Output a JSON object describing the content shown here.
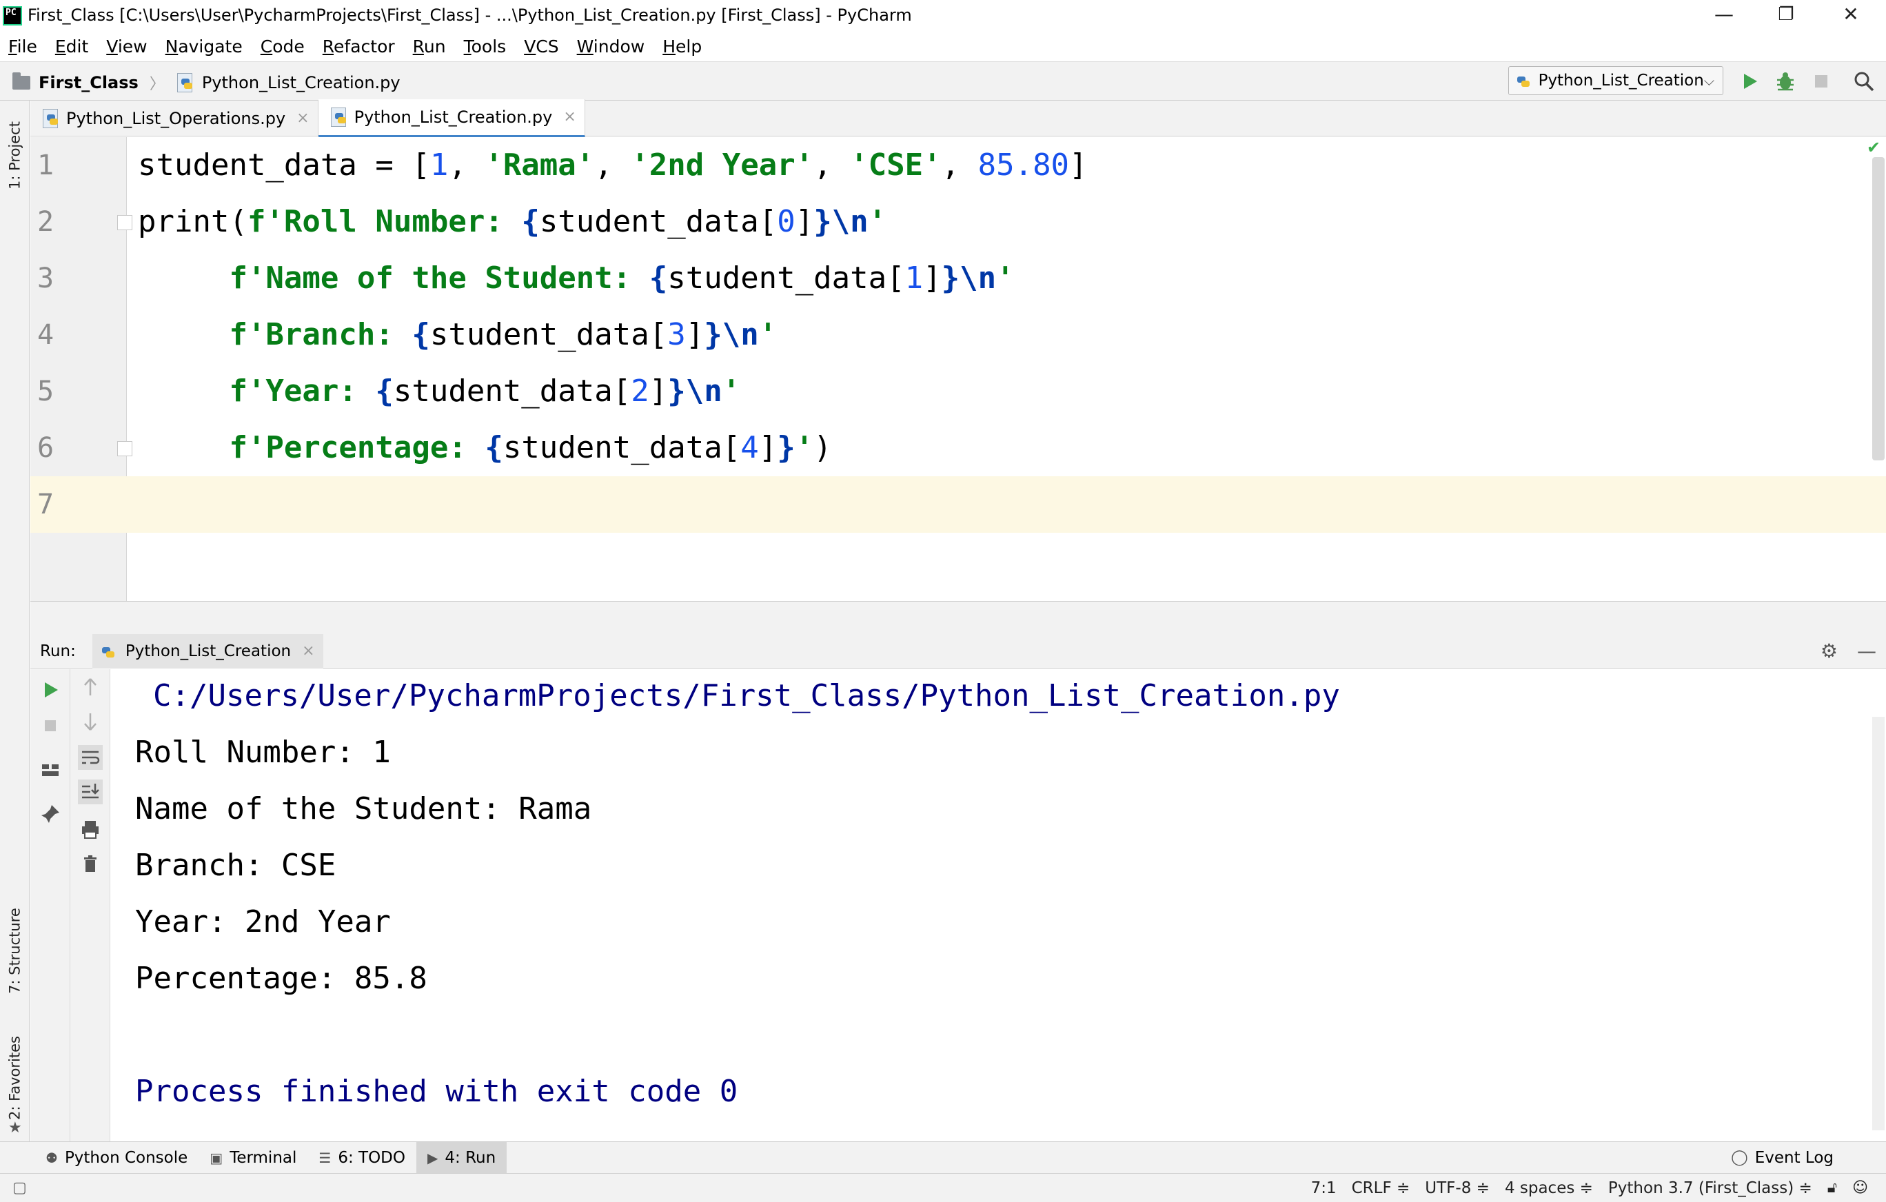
{
  "window": {
    "title": "First_Class [C:\\Users\\User\\PycharmProjects\\First_Class] - ...\\Python_List_Creation.py [First_Class] - PyCharm",
    "app_icon_text": "PC",
    "minimize": "—",
    "restore": "❐",
    "close": "✕"
  },
  "menu": [
    "File",
    "Edit",
    "View",
    "Navigate",
    "Code",
    "Refactor",
    "Run",
    "Tools",
    "VCS",
    "Window",
    "Help"
  ],
  "navbar": {
    "project": "First_Class",
    "file": "Python_List_Creation.py",
    "run_config": "Python_List_Creation"
  },
  "left_strip": {
    "project": "1: Project",
    "structure": "7: Structure",
    "favorites": "2: Favorites"
  },
  "editor_tabs": [
    {
      "label": "Python_List_Operations.py",
      "active": false
    },
    {
      "label": "Python_List_Creation.py",
      "active": true
    }
  ],
  "editor": {
    "line_numbers": [
      "1",
      "2",
      "3",
      "4",
      "5",
      "6",
      "7"
    ],
    "current_line": 7
  },
  "run_panel": {
    "label": "Run:",
    "tab": "Python_List_Creation",
    "output": {
      "path": "C:/Users/User/PycharmProjects/First_Class/Python_List_Creation.py",
      "lines": [
        "Roll Number: 1",
        "Name of the Student: Rama",
        "Branch: CSE",
        "Year: 2nd Year",
        "Percentage: 85.8"
      ],
      "exit": "Process finished with exit code 0"
    }
  },
  "bottom_tools": [
    {
      "label": "Python Console",
      "icon": "python-console-icon",
      "active": false
    },
    {
      "label": "Terminal",
      "icon": "terminal-icon",
      "active": false
    },
    {
      "label": "6: TODO",
      "icon": "todo-icon",
      "active": false
    },
    {
      "label": "4: Run",
      "icon": "run-icon",
      "active": true
    }
  ],
  "event_log": "Event Log",
  "status": {
    "position": "7:1",
    "line_sep": "CRLF ≑",
    "encoding": "UTF-8 ≑",
    "indent": "4 spaces ≑",
    "interpreter": "Python 3.7 (First_Class) ≑"
  }
}
